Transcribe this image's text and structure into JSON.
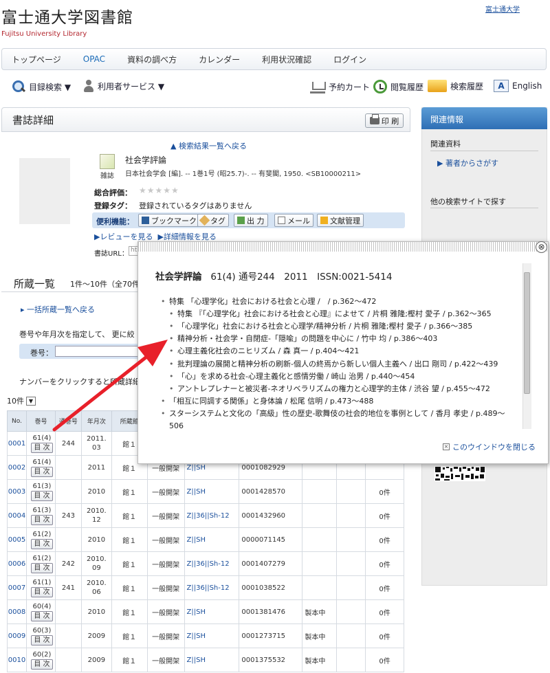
{
  "site": {
    "title": "富士通大学図書館",
    "subtitle": "Fujitsu University Library",
    "univ_link": "富士通大学"
  },
  "nav": [
    {
      "label": "トップページ",
      "active": false
    },
    {
      "label": "OPAC",
      "active": true
    },
    {
      "label": "資料の調べ方",
      "active": false
    },
    {
      "label": "カレンダー",
      "active": false
    },
    {
      "label": "利用状況確認",
      "active": false
    },
    {
      "label": "ログイン",
      "active": false
    }
  ],
  "tools": {
    "catalog_search": "目録検索 ▼",
    "user_services": "利用者サービス ▼",
    "reserve_cart": "予約カート",
    "view_history": "閲覧履歴",
    "search_history": "検索履歴",
    "english": "English"
  },
  "main": {
    "title": "書誌詳細",
    "print": "印 刷",
    "back_to_results": "▲ 検索結果一覧へ戻る",
    "journal_label": "雑誌",
    "book_title": "社会学評論",
    "book_meta": "日本社会学会 [編]. -- 1巻1号 (昭25.7)-. -- 有斐閣, 1950. <SB10000211>",
    "rating_label": "総合評価：",
    "stars": "★★★★★",
    "tag_label": "登録タグ：",
    "tag_value": "登録されているタグはありません",
    "util_label": "便利機能：",
    "util_buttons": [
      "ブックマーク",
      "タグ",
      "出 力",
      "メール",
      "文献管理"
    ],
    "review_link": "▶レビューを見る",
    "detail_link": "▶詳細情報を見る",
    "url_label": "書誌URL：",
    "url_value": "ht"
  },
  "holdings": {
    "title": "所蔵一覧",
    "count": "1件～10件（全70件）",
    "all_list_link": "一括所蔵一覧へ戻る",
    "specify_text": "巻号や年月次を指定して、 更に絞",
    "vol_label": "巻号：",
    "click_text": "ナンバーをクリックすると所蔵詳細",
    "per_page": "10件",
    "headers": [
      "No.",
      "巻号",
      "通巻号",
      "年月次",
      "所蔵館",
      "",
      "",
      "",
      "",
      "",
      ""
    ],
    "toc_label": "目 次",
    "rows": [
      {
        "no": "0001",
        "vol": "61(4)",
        "total": "244",
        "date": "2011.\n03",
        "lib": "館１",
        "loc": "",
        "call": "",
        "barcode": "",
        "status": "",
        "res": ""
      },
      {
        "no": "0002",
        "vol": "61(4)",
        "total": "",
        "date": "2011",
        "lib": "館１",
        "loc": "一般開架",
        "call": "Z||SH",
        "barcode": "0001082929",
        "status": "",
        "res": ""
      },
      {
        "no": "0003",
        "vol": "61(3)",
        "total": "",
        "date": "2010",
        "lib": "館１",
        "loc": "一般開架",
        "call": "Z||SH",
        "barcode": "0001428570",
        "status": "",
        "res": "0件"
      },
      {
        "no": "0004",
        "vol": "61(3)",
        "total": "243",
        "date": "2010.\n12",
        "lib": "館１",
        "loc": "一般開架",
        "call": "Z||36||Sh-12",
        "barcode": "0001432960",
        "status": "",
        "res": "0件"
      },
      {
        "no": "0005",
        "vol": "61(2)",
        "total": "",
        "date": "2010",
        "lib": "館１",
        "loc": "一般開架",
        "call": "Z||SH",
        "barcode": "0000071145",
        "status": "",
        "res": "0件"
      },
      {
        "no": "0006",
        "vol": "61(2)",
        "total": "242",
        "date": "2010.\n09",
        "lib": "館１",
        "loc": "一般開架",
        "call": "Z||36||Sh-12",
        "barcode": "0001407279",
        "status": "",
        "res": "0件"
      },
      {
        "no": "0007",
        "vol": "61(1)",
        "total": "241",
        "date": "2010.\n06",
        "lib": "館１",
        "loc": "一般開架",
        "call": "Z||36||Sh-12",
        "barcode": "0001038522",
        "status": "",
        "res": "0件"
      },
      {
        "no": "0008",
        "vol": "60(4)",
        "total": "",
        "date": "2010",
        "lib": "館１",
        "loc": "一般開架",
        "call": "Z||SH",
        "barcode": "0001381476",
        "status": "製本中",
        "res": "0件"
      },
      {
        "no": "0009",
        "vol": "60(3)",
        "total": "",
        "date": "2009",
        "lib": "館１",
        "loc": "一般開架",
        "call": "Z||SH",
        "barcode": "0001273715",
        "status": "製本中",
        "res": "0件"
      },
      {
        "no": "0010",
        "vol": "60(2)",
        "total": "",
        "date": "2009",
        "lib": "館１",
        "loc": "一般開架",
        "call": "Z||SH",
        "barcode": "0001375532",
        "status": "製本中",
        "res": "0件"
      }
    ]
  },
  "side": {
    "header": "関連情報",
    "related_heading": "関連資料",
    "author_link": "著者からさがす",
    "other_sites_heading": "他の検索サイトで探す"
  },
  "modal": {
    "journal": "社会学評論",
    "issue_info": "61(4) 通号244　2011　ISSN:0021-5414",
    "close_icon": "⊗",
    "close_link": "このウインドウを閉じる",
    "toc": [
      {
        "level": 0,
        "text": "特集 「心理学化」社会における社会と心理 /　/ p.362～472"
      },
      {
        "level": 1,
        "text": "特集 『「心理学化」社会における社会と心理』によせて / 片桐 雅隆;樫村 愛子 / p.362～365"
      },
      {
        "level": 1,
        "text": "「心理学化」社会における社会と心理学/精神分析 / 片桐 雅隆;樫村 愛子 / p.366～385"
      },
      {
        "level": 1,
        "text": "精神分析・社会学・自閉症-「隠喩」の問題を中心に / 竹中 均 / p.386～403"
      },
      {
        "level": 1,
        "text": "心理主義化社会のニヒリズム / 森 真一 / p.404～421"
      },
      {
        "level": 1,
        "text": "批判理論の展開と精神分析の刷新-個人の終焉から新しい個人主義へ / 出口 剛司 / p.422～439"
      },
      {
        "level": 1,
        "text": "「心」を求める社会-心理主義化と感情労働 / 崎山 治男 / p.440～454"
      },
      {
        "level": 1,
        "text": "アントレプレナーと被災者-ネオリベラリズムの権力と心理学的主体 / 渋谷 望 / p.455～472"
      },
      {
        "level": 0,
        "text": "「相互に同調する関係」と身体論 / 松尾 信明 / p.473～488"
      },
      {
        "level": 0,
        "text": "スターシステムと文化の「高級」性の歴史-歌舞伎の社会的地位を事例として / 香月 孝史 / p.489～506"
      }
    ]
  }
}
